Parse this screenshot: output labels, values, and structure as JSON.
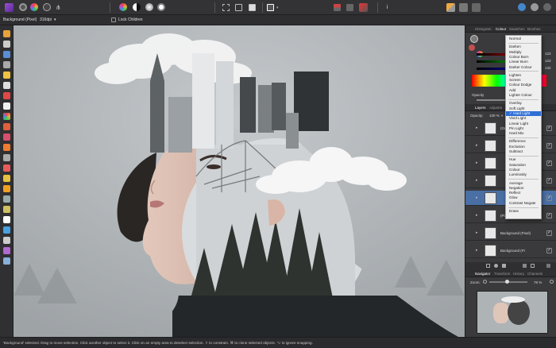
{
  "context_bar": {
    "layer_name": "Background (Pixel)",
    "dpi": "316dpi",
    "lock_children": "Lock Children"
  },
  "colour_panel": {
    "tabs": [
      "Histogram",
      "Colour",
      "Swatches",
      "Brushes"
    ],
    "active_tab": "Colour",
    "values": [
      "123",
      "123",
      "132"
    ],
    "opacity_label": "Opacity"
  },
  "layers_panel": {
    "tabs": [
      "Layers",
      "Adjustm"
    ],
    "active_tab": "Layers",
    "opacity_label": "Opacity:",
    "opacity_value": "100 %",
    "layers": [
      {
        "name": "(Grou",
        "selected": false
      },
      {
        "name": "",
        "selected": false
      },
      {
        "name": "",
        "selected": false
      },
      {
        "name": "",
        "selected": false
      },
      {
        "name": "",
        "selected": true
      },
      {
        "name": "(Pixel)",
        "selected": false
      },
      {
        "name": "Background (Pixel)",
        "selected": false
      },
      {
        "name": "Background (Pi",
        "selected": false
      }
    ]
  },
  "blend_modes": {
    "selected": "Hard Light",
    "groups": [
      [
        "Normal"
      ],
      [
        "Darken",
        "Multiply",
        "Colour Burn",
        "Linear Burn",
        "Darker Colour"
      ],
      [
        "Lighten",
        "Screen",
        "Colour Dodge",
        "Add",
        "Lighter Colour"
      ],
      [
        "Overlay",
        "Soft Light",
        "Hard Light",
        "Vivid Light",
        "Linear Light",
        "Pin Light",
        "Hard Mix"
      ],
      [
        "Difference",
        "Exclusion",
        "Subtract"
      ],
      [
        "Hue",
        "Saturation",
        "Colour",
        "Luminosity"
      ],
      [
        "Average",
        "Negation",
        "Reflect",
        "Glow",
        "Contrast Negate"
      ],
      [
        "Erase"
      ]
    ]
  },
  "navigator_panel": {
    "tabs": [
      "Navigator",
      "Transform",
      "History",
      "Channels"
    ],
    "active_tab": "Navigator",
    "zoom_label": "Zoom:",
    "zoom_value": "78 %"
  },
  "status_bar": {
    "text": "'Background' selected. Drag to move selection. Click another object to select it. Click on an empty area to deselect selection. ⇧ to constrain. ⌘ to clone selected objects. ⌥ to ignore snapping."
  },
  "colors": {
    "accent": "#2f6fd6",
    "selected_layer": "#4a6fa5",
    "app_icon": "#7b3fb5"
  }
}
